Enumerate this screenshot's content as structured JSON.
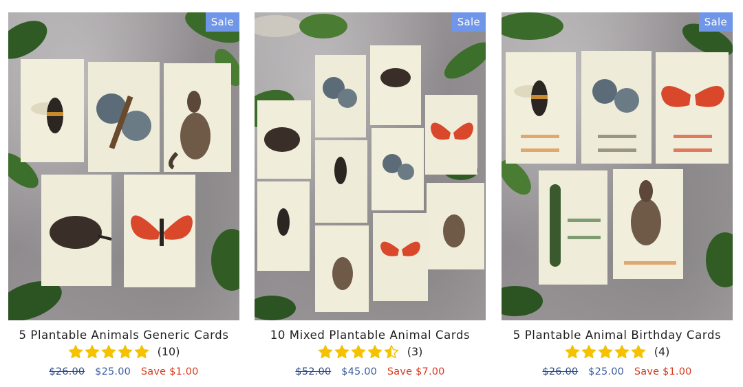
{
  "colors": {
    "sale_badge": "#6f96e8",
    "star": "#f5c200",
    "compare_price": "#2b4a86",
    "price": "#3a5c9e",
    "savings": "#d93a1e"
  },
  "products": [
    {
      "badge": "Sale",
      "title": "5 Plantable Animals Generic Cards",
      "rating": 5,
      "review_count": "(10)",
      "compare_price": "$26.00",
      "price": "$25.00",
      "savings": "Save $1.00",
      "image_icon": "generic-animal-cards-image"
    },
    {
      "badge": "Sale",
      "title": "10 Mixed Plantable Animal Cards",
      "rating": 4.5,
      "review_count": "(3)",
      "compare_price": "$52.00",
      "price": "$45.00",
      "savings": "Save $7.00",
      "image_icon": "mixed-animal-cards-image"
    },
    {
      "badge": "Sale",
      "title": "5 Plantable Animal Birthday Cards",
      "rating": 5,
      "review_count": "(4)",
      "compare_price": "$26.00",
      "price": "$25.00",
      "savings": "Save $1.00",
      "image_icon": "birthday-animal-cards-image"
    }
  ]
}
